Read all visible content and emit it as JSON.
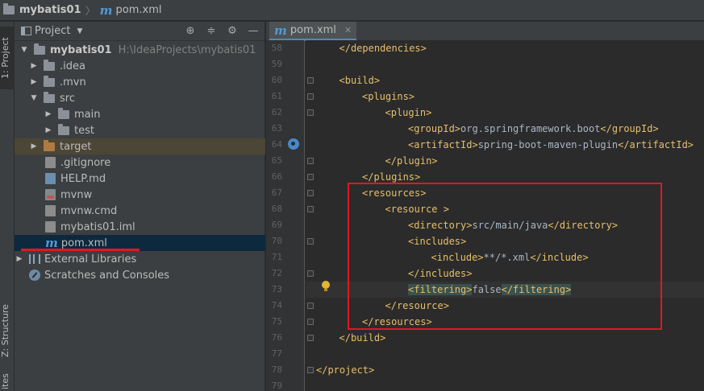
{
  "breadcrumb": {
    "project": "mybatis01",
    "file": "pom.xml"
  },
  "side_tabs": {
    "project": "1: Project",
    "structure": "Z: Structure",
    "favorites": "ites"
  },
  "project_panel": {
    "title": "Project",
    "root": {
      "name": "mybatis01",
      "path": "H:\\IdeaProjects\\mybatis01"
    },
    "items": [
      {
        "label": ".idea"
      },
      {
        "label": ".mvn"
      },
      {
        "label": "src"
      },
      {
        "label": "main"
      },
      {
        "label": "test"
      },
      {
        "label": "target"
      },
      {
        "label": ".gitignore"
      },
      {
        "label": "HELP.md"
      },
      {
        "label": "mvnw"
      },
      {
        "label": "mvnw.cmd"
      },
      {
        "label": "mybatis01.iml"
      },
      {
        "label": "pom.xml"
      },
      {
        "label": "External Libraries"
      },
      {
        "label": "Scratches and Consoles"
      }
    ]
  },
  "editor": {
    "tab_label": "pom.xml",
    "lines": [
      {
        "num": "58",
        "indent": 1,
        "parts": [
          [
            "tag",
            "</dependencies>"
          ]
        ]
      },
      {
        "num": "59",
        "indent": 0,
        "parts": []
      },
      {
        "num": "60",
        "indent": 1,
        "parts": [
          [
            "tag",
            "<build>"
          ]
        ]
      },
      {
        "num": "61",
        "indent": 2,
        "parts": [
          [
            "tag",
            "<plugins>"
          ]
        ]
      },
      {
        "num": "62",
        "indent": 3,
        "parts": [
          [
            "tag",
            "<plugin>"
          ]
        ]
      },
      {
        "num": "63",
        "indent": 4,
        "parts": [
          [
            "tag",
            "<groupId>"
          ],
          [
            "txt",
            "org.springframework.boot"
          ],
          [
            "tag",
            "</groupId>"
          ]
        ]
      },
      {
        "num": "64",
        "indent": 4,
        "parts": [
          [
            "tag",
            "<artifactId>"
          ],
          [
            "txt",
            "spring-boot-maven-plugin"
          ],
          [
            "tag",
            "</artifactId>"
          ]
        ]
      },
      {
        "num": "65",
        "indent": 3,
        "parts": [
          [
            "tag",
            "</plugin>"
          ]
        ]
      },
      {
        "num": "66",
        "indent": 2,
        "parts": [
          [
            "tag",
            "</plugins>"
          ]
        ]
      },
      {
        "num": "67",
        "indent": 2,
        "parts": [
          [
            "tag",
            "<resources>"
          ]
        ]
      },
      {
        "num": "68",
        "indent": 3,
        "parts": [
          [
            "tag",
            "<resource >"
          ]
        ]
      },
      {
        "num": "69",
        "indent": 4,
        "parts": [
          [
            "tag",
            "<directory>"
          ],
          [
            "txt",
            "src/main/java"
          ],
          [
            "tag",
            "</directory>"
          ]
        ]
      },
      {
        "num": "70",
        "indent": 4,
        "parts": [
          [
            "tag",
            "<includes>"
          ]
        ]
      },
      {
        "num": "71",
        "indent": 5,
        "parts": [
          [
            "tag",
            "<include>"
          ],
          [
            "txt",
            "**/*.xml"
          ],
          [
            "tag",
            "</include>"
          ]
        ]
      },
      {
        "num": "72",
        "indent": 4,
        "parts": [
          [
            "tag",
            "</includes>"
          ]
        ]
      },
      {
        "num": "73",
        "indent": 4,
        "parts": [
          [
            "hl",
            "<filtering>"
          ],
          [
            "txt",
            "false"
          ],
          [
            "hl",
            "</filtering>"
          ]
        ]
      },
      {
        "num": "74",
        "indent": 3,
        "parts": [
          [
            "tag",
            "</resource>"
          ]
        ]
      },
      {
        "num": "75",
        "indent": 2,
        "parts": [
          [
            "tag",
            "</resources>"
          ]
        ]
      },
      {
        "num": "76",
        "indent": 1,
        "parts": [
          [
            "tag",
            "</build>"
          ]
        ]
      },
      {
        "num": "77",
        "indent": 0,
        "parts": []
      },
      {
        "num": "78",
        "indent": 0,
        "parts": [
          [
            "tag",
            "</project>"
          ]
        ]
      },
      {
        "num": "79",
        "indent": 0,
        "parts": []
      }
    ]
  },
  "colors": {
    "tag": "#e8bf6a",
    "text": "#a9b7c6",
    "annotation_red": "#e0181e"
  }
}
